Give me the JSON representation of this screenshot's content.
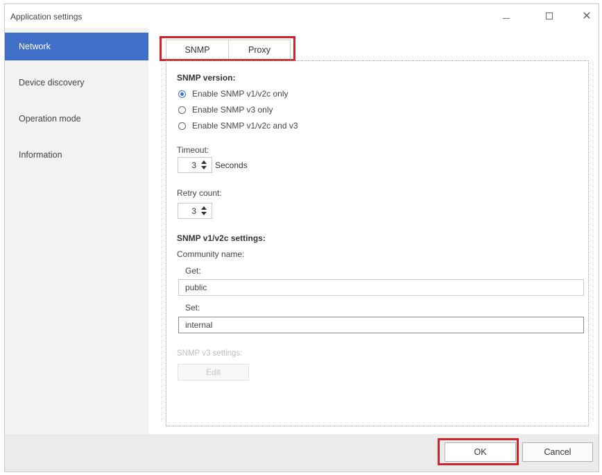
{
  "window": {
    "title": "Application settings",
    "minimize_icon": "minimize-icon",
    "maximize_icon": "maximize-icon",
    "close_icon": "close-icon",
    "close_glyph": "✕"
  },
  "sidebar": {
    "items": [
      {
        "label": "Network",
        "active": true
      },
      {
        "label": "Device discovery",
        "active": false
      },
      {
        "label": "Operation mode",
        "active": false
      },
      {
        "label": "Information",
        "active": false
      }
    ]
  },
  "tabs": [
    {
      "label": "SNMP",
      "active": true
    },
    {
      "label": "Proxy",
      "active": false
    }
  ],
  "snmp": {
    "version_title": "SNMP version:",
    "options": [
      {
        "label": "Enable SNMP v1/v2c only",
        "checked": true
      },
      {
        "label": "Enable SNMP v3 only",
        "checked": false
      },
      {
        "label": "Enable SNMP v1/v2c and v3",
        "checked": false
      }
    ],
    "timeout_label": "Timeout:",
    "timeout_value": "3",
    "timeout_unit": "Seconds",
    "retry_label": "Retry count:",
    "retry_value": "3",
    "v1v2c_title": "SNMP v1/v2c settings:",
    "community_label": "Community name:",
    "get_label": "Get:",
    "get_value": "public",
    "set_label": "Set:",
    "set_value": "internal",
    "v3_title": "SNMP v3 settings:",
    "edit_label": "Edit"
  },
  "footer": {
    "ok_label": "OK",
    "cancel_label": "Cancel"
  },
  "colors": {
    "accent": "#3f6fc7",
    "highlight": "#d2232a"
  }
}
